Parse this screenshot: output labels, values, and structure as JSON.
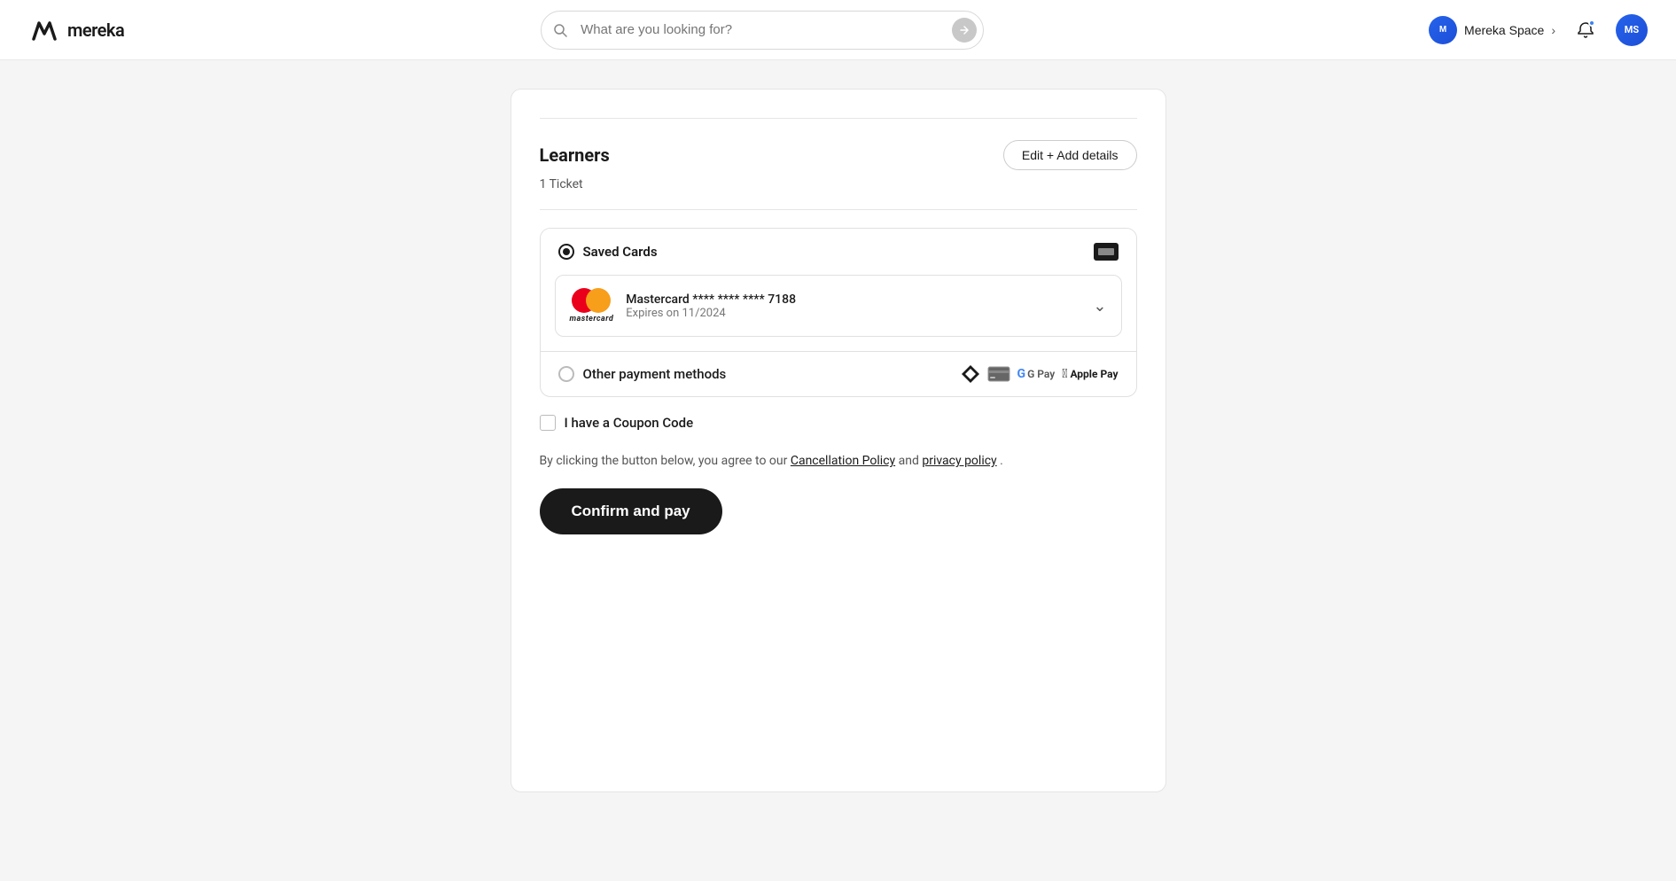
{
  "header": {
    "logo_text": "mereka",
    "search_placeholder": "What are you looking for?",
    "workspace_name": "Mereka Space",
    "workspace_avatar_initials": "M",
    "user_avatar_initials": "MS"
  },
  "learners": {
    "section_title": "Learners",
    "ticket_count": "1 Ticket",
    "edit_button_label": "Edit + Add details"
  },
  "payment": {
    "saved_cards_label": "Saved Cards",
    "card_brand": "Mastercard",
    "card_number_masked": "**** **** **** 7188",
    "card_expiry": "Expires on 11/2024",
    "other_payment_label": "Other payment methods",
    "gpay_label": "G Pay",
    "apple_pay_label": "Apple Pay"
  },
  "coupon": {
    "label": "I have a Coupon Code"
  },
  "terms": {
    "prefix": "By clicking the button below, you agree to our ",
    "cancellation_policy_link": "Cancellation Policy",
    "and_text": " and ",
    "privacy_policy_link": "privacy policy",
    "suffix": "."
  },
  "confirm_button": {
    "label": "Confirm and pay"
  }
}
